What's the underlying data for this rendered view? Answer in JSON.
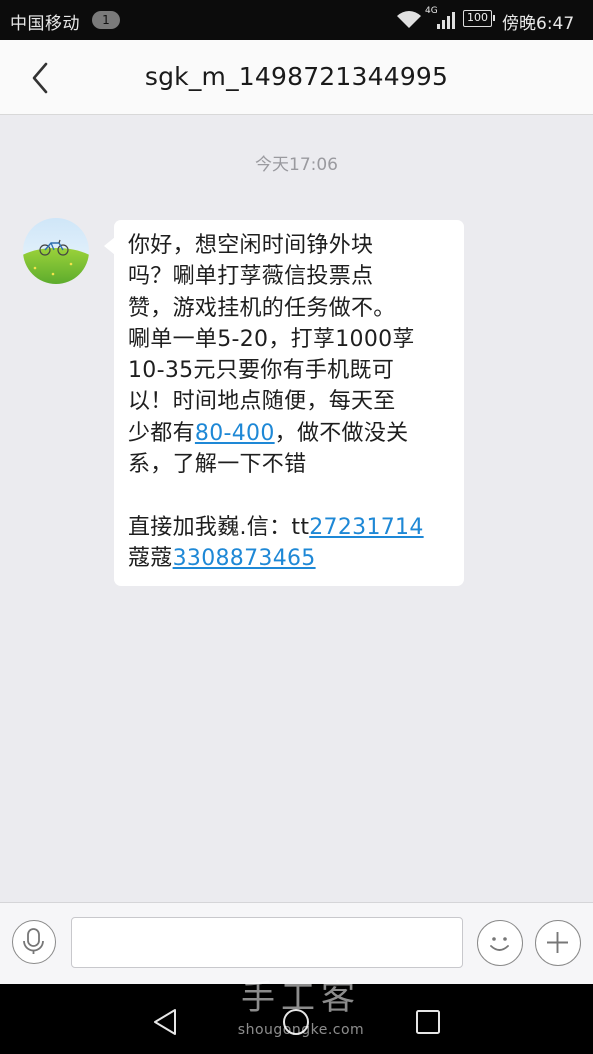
{
  "status_bar": {
    "carrier": "中国移动",
    "notification_count": "1",
    "network": "4G",
    "battery": "100",
    "time": "傍晚6:47"
  },
  "header": {
    "title": "sgk_m_1498721344995",
    "back_icon": "chevron-left-icon"
  },
  "conversation": {
    "timestamp": "今天17:06",
    "message": {
      "lines": [
        {
          "text": "你好，想空闲时间铮外块"
        },
        {
          "text": "吗？唰单打莩薇信投票点"
        },
        {
          "text": "赞，游戏挂机的任务做不。"
        },
        {
          "text": "唰单一单5-20，打莩1000莩"
        },
        {
          "text": "10-35元只要你有手机既可"
        },
        {
          "text": "以！时间地点随便，每天至"
        },
        {
          "before": "少都有",
          "link": "80-400",
          "after": "，做不做没关"
        },
        {
          "text": "系，了解一下不错"
        },
        {
          "contact_before": "直接加我巍.信：tt",
          "contact_link": "27231714"
        },
        {
          "contact_before": "蔻蔻",
          "contact_link": "3308873465"
        }
      ]
    }
  },
  "input_bar": {
    "message_value": "",
    "voice_icon": "microphone-icon",
    "emoji_icon": "smiley-icon",
    "add_icon": "plus-icon"
  },
  "nav_bar": {
    "back_icon": "triangle-back-icon",
    "home_icon": "circle-home-icon",
    "recents_icon": "square-recents-icon"
  },
  "watermark": {
    "name": "手工客",
    "url": "shougongke.com"
  }
}
